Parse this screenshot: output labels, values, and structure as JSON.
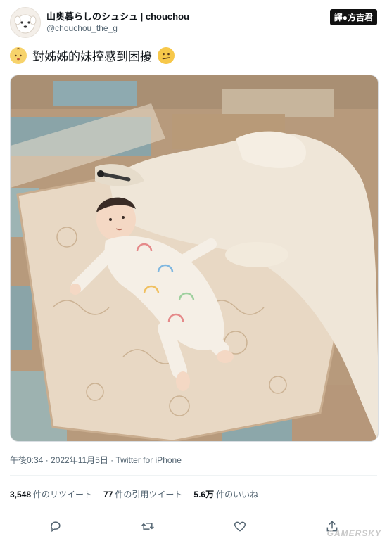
{
  "user": {
    "display_name": "山奥暮らしのシュシュ | chouchou",
    "handle": "@chouchou_the_g"
  },
  "translator_badge": "譯●方吉君",
  "tweet": {
    "text": "對姊姊的妹控感到困擾"
  },
  "photo": {
    "description_icon": "photo"
  },
  "meta": {
    "timestamp": "午後0:34 · 2022年11月5日 · Twitter for iPhone"
  },
  "stats": {
    "retweets_count": "3,548",
    "retweets_label": "件のリツイート",
    "quotes_count": "77",
    "quotes_label": "件の引用ツイート",
    "likes_count": "5.6万",
    "likes_label": "件のいいね"
  },
  "actions": {
    "reply_icon": "reply-icon",
    "retweet_icon": "retweet-icon",
    "like_icon": "heart-icon",
    "share_icon": "share-icon"
  },
  "watermark": "GAMERSKY",
  "colors": {
    "text_primary": "#0f1419",
    "text_secondary": "#536471",
    "divider": "#eff3f4"
  }
}
